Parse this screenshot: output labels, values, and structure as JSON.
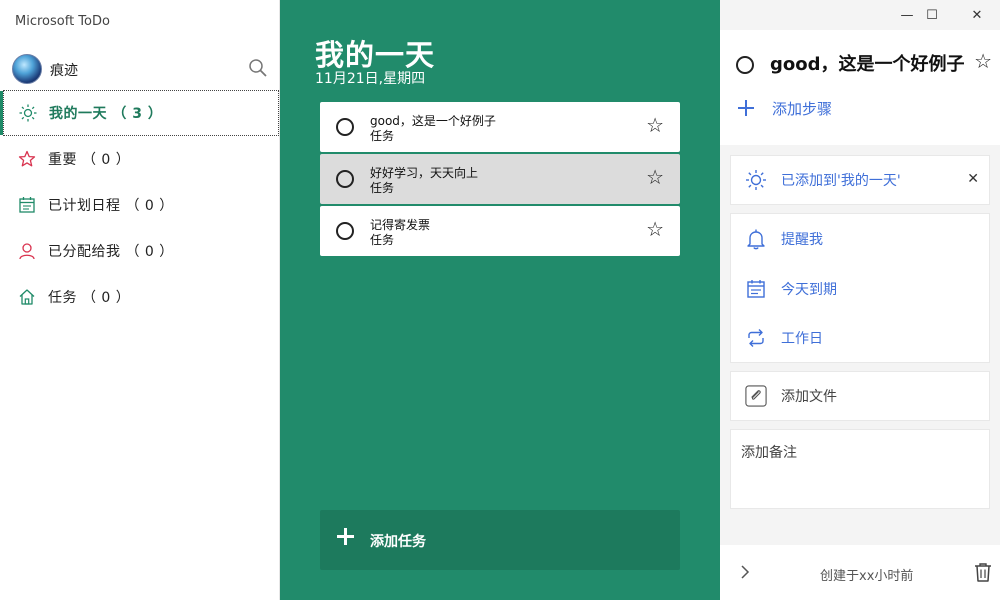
{
  "app": {
    "title": "Microsoft ToDo"
  },
  "user": {
    "name": "痕迹"
  },
  "nav": {
    "items": [
      {
        "label": "我的一天 （ 3 ）",
        "icon": "sun-icon"
      },
      {
        "label": "重要 （ 0 ）",
        "icon": "star-icon"
      },
      {
        "label": "已计划日程 （ 0 ）",
        "icon": "calendar-icon"
      },
      {
        "label": "已分配给我 （ 0 ）",
        "icon": "person-icon"
      },
      {
        "label": "任务 （ 0 ）",
        "icon": "home-icon"
      }
    ]
  },
  "main": {
    "title": "我的一天",
    "date": "11月21日,星期四",
    "tasks": [
      {
        "title": "good，这是一个好例子",
        "list": "任务",
        "star": "☆"
      },
      {
        "title": "好好学习，天天向上",
        "list": "任务",
        "star": "☆"
      },
      {
        "title": "记得寄发票",
        "list": "任务",
        "star": "☆"
      }
    ],
    "add_task_label": "添加任务"
  },
  "detail": {
    "task_title": "good，这是一个好例子",
    "star": "☆",
    "add_step_label": "添加步骤",
    "my_day_label": "已添加到'我的一天'",
    "remind_label": "提醒我",
    "due_label": "今天到期",
    "repeat_label": "工作日",
    "add_file_label": "添加文件",
    "note_placeholder": "添加备注",
    "created_text": "创建于xx小时前"
  },
  "window": {
    "minimize": "—",
    "maximize": "☐",
    "close": "✕"
  },
  "colors": {
    "accent": "#218b6b",
    "link_blue": "#3f6fd8",
    "selected_nav": "#1f7a5c"
  }
}
